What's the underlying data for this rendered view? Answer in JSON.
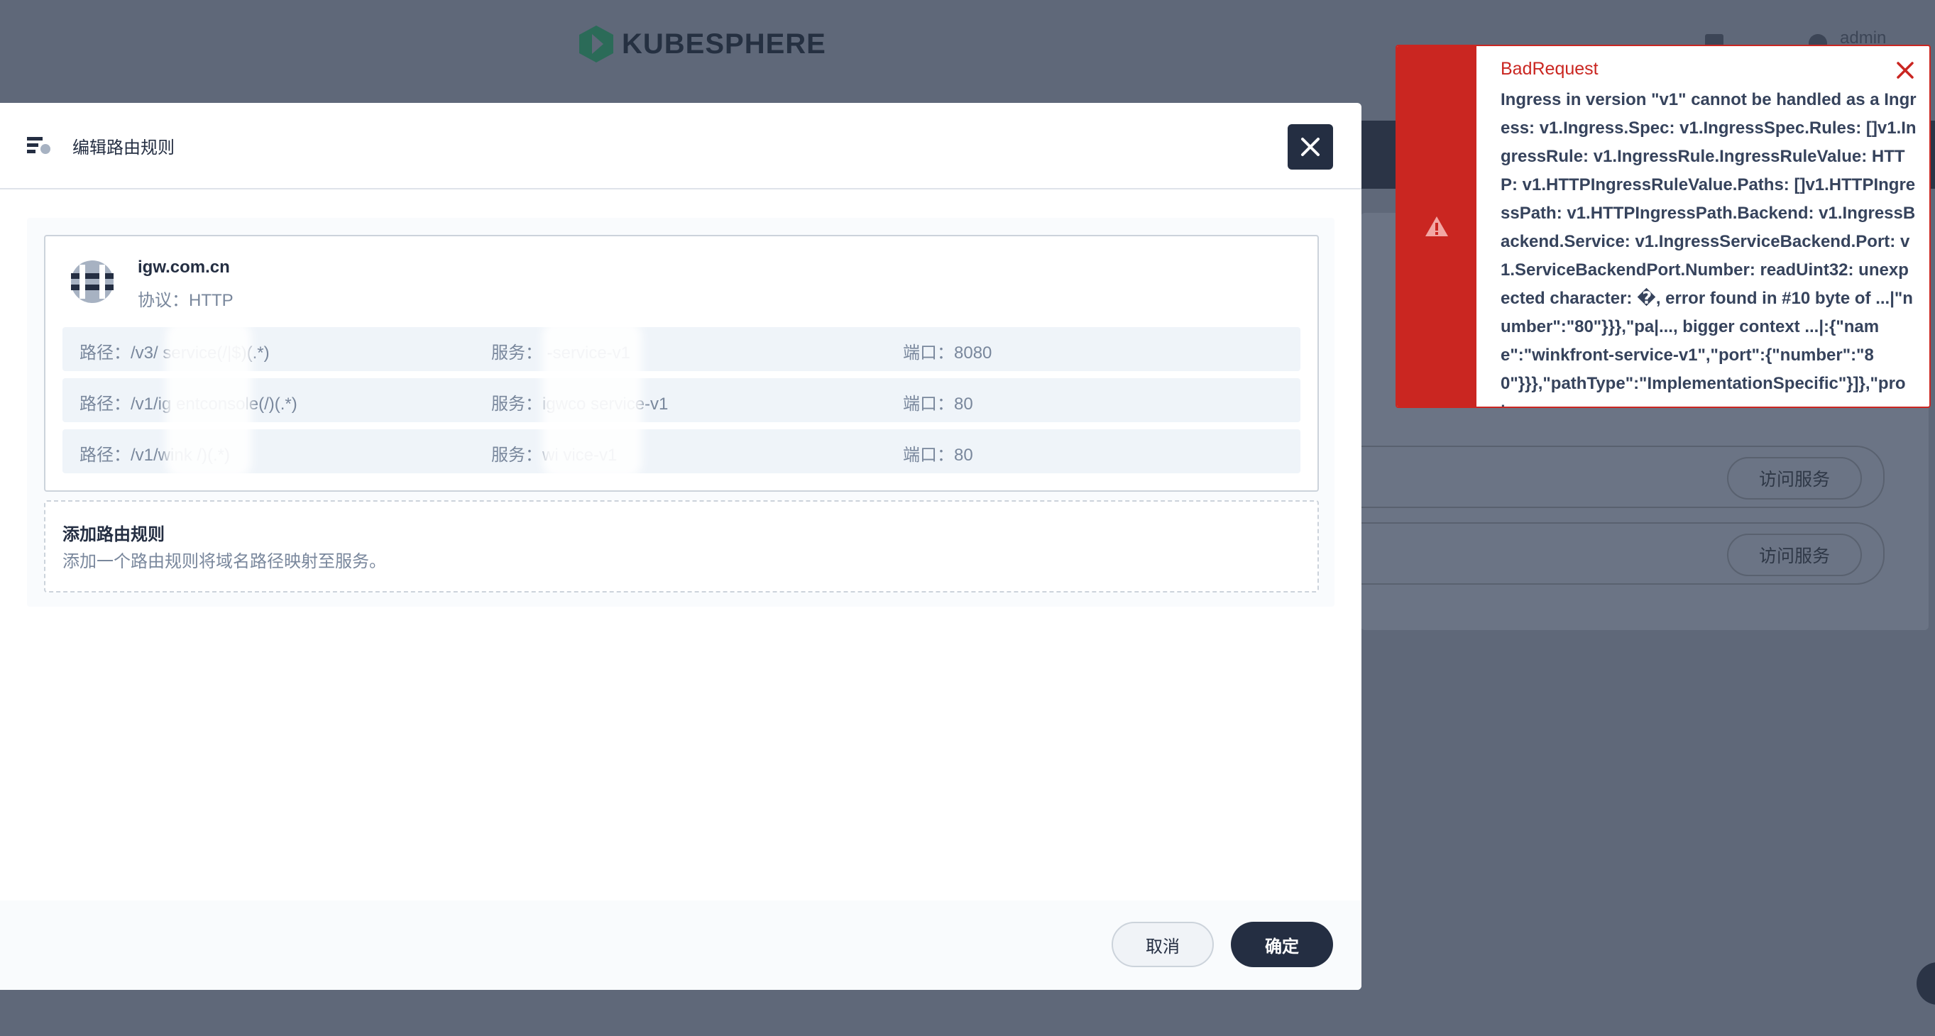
{
  "app": {
    "logo_text": "KUBESPHERE",
    "user": "admin"
  },
  "background": {
    "rows": [
      {
        "button": "访问服务"
      },
      {
        "button": "访问服务"
      }
    ]
  },
  "modal": {
    "title": "编辑路由规则",
    "rule": {
      "host": "igw.com.cn",
      "protocol": "协议：HTTP",
      "paths": [
        {
          "path": "路径：/v3/     service(/|$)(.*)",
          "service": "服务：          -service-v1",
          "port": "端口：8080"
        },
        {
          "path": "路径：/v1/ig       entconsole(/)(.*)",
          "service": "服务：igwco        service-v1",
          "port": "端口：80"
        },
        {
          "path": "路径：/v1/wink       /)(.*)",
          "service": "服务：wi          vice-v1",
          "port": "端口：80"
        }
      ]
    },
    "add_rule": {
      "title": "添加路由规则",
      "description": "添加一个路由规则将域名路径映射至服务。"
    },
    "buttons": {
      "cancel": "取消",
      "ok": "确定"
    }
  },
  "notification": {
    "title": "BadRequest",
    "message": "Ingress in version \"v1\" cannot be handled as a Ingress: v1.Ingress.Spec: v1.IngressSpec.Rules: []v1.IngressRule: v1.IngressRule.IngressRuleValue: HTTP: v1.HTTPIngressRuleValue.Paths: []v1.HTTPIngressPath: v1.HTTPIngressPath.Backend: v1.IngressBackend.Service: v1.IngressServiceBackend.Port: v1.ServiceBackendPort.Number: readUint32: unexpected character: �, error found in #10 byte of ...|\"number\":\"80\"}}},\"pa|..., bigger context ...|:{\"name\":\"winkfront-service-v1\",\"port\":{\"number\":\"80\"}}},\"pathType\":\"ImplementationSpecific\"}]},\"pro|..."
  },
  "colors": {
    "error": "#ca2621",
    "dark": "#242e42",
    "overlay": "#5f6879"
  },
  "icons": [
    "kubesphere-logo-icon",
    "route-icon",
    "close-icon",
    "globe-icon",
    "warning-icon"
  ]
}
